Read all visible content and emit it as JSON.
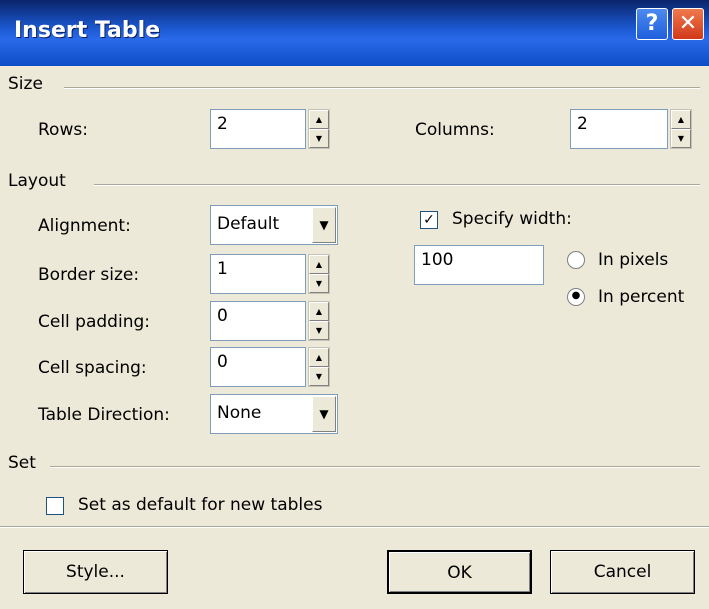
{
  "window": {
    "title": "Insert Table",
    "help_glyph": "?",
    "close_glyph": "✕"
  },
  "size": {
    "heading": "Size",
    "rows_label": "Rows:",
    "rows_value": "2",
    "columns_label": "Columns:",
    "columns_value": "2"
  },
  "layout": {
    "heading": "Layout",
    "alignment_label": "Alignment:",
    "alignment_value": "Default",
    "border_size_label": "Border size:",
    "border_size_value": "1",
    "cell_padding_label": "Cell padding:",
    "cell_padding_value": "0",
    "cell_spacing_label": "Cell spacing:",
    "cell_spacing_value": "0",
    "table_direction_label": "Table Direction:",
    "table_direction_value": "None",
    "specify_width_label": "Specify width:",
    "specify_width_checked": true,
    "width_value": "100",
    "in_pixels_label": "In pixels",
    "in_percent_label": "In percent",
    "selected_unit": "percent"
  },
  "set": {
    "heading": "Set",
    "default_checkbox_label": "Set as default for new tables",
    "default_checked": false
  },
  "buttons": {
    "style_label": "Style...",
    "ok_label": "OK",
    "cancel_label": "Cancel"
  },
  "colors": {
    "dialog_bg": "#ece9d8",
    "titlebar_blue": "#1d5bd6",
    "close_red": "#d2391a"
  }
}
